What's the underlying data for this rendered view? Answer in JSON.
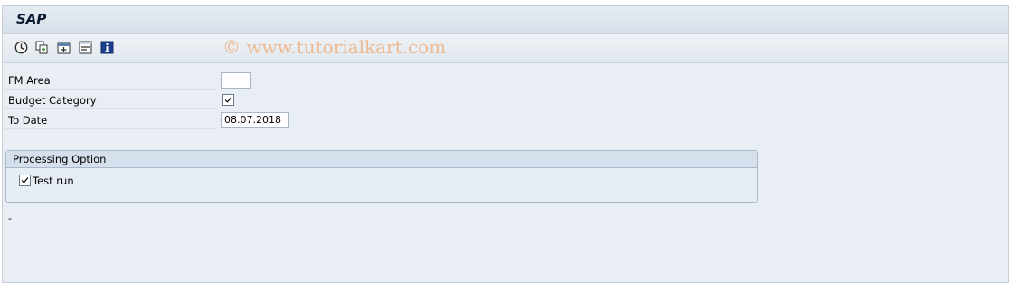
{
  "window": {
    "title": "SAP"
  },
  "toolbar": {
    "icons": [
      "execute-icon",
      "copy-variant-icon",
      "get-variant-icon",
      "selection-options-icon",
      "info-icon"
    ]
  },
  "watermark": "© www.tutorialkart.com",
  "fields": {
    "fm_area": {
      "label": "FM Area",
      "value": ""
    },
    "budget_category": {
      "label": "Budget Category",
      "checked": true
    },
    "to_date": {
      "label": "To Date",
      "value": "08.07.2018"
    }
  },
  "processing_option": {
    "title": "Processing Option",
    "test_run": {
      "label": "Test run",
      "checked": true
    }
  },
  "status_text": "-",
  "colors": {
    "background": "#e9eef4",
    "watermark": "#efb98f",
    "group_header": "#d5e0ec"
  }
}
